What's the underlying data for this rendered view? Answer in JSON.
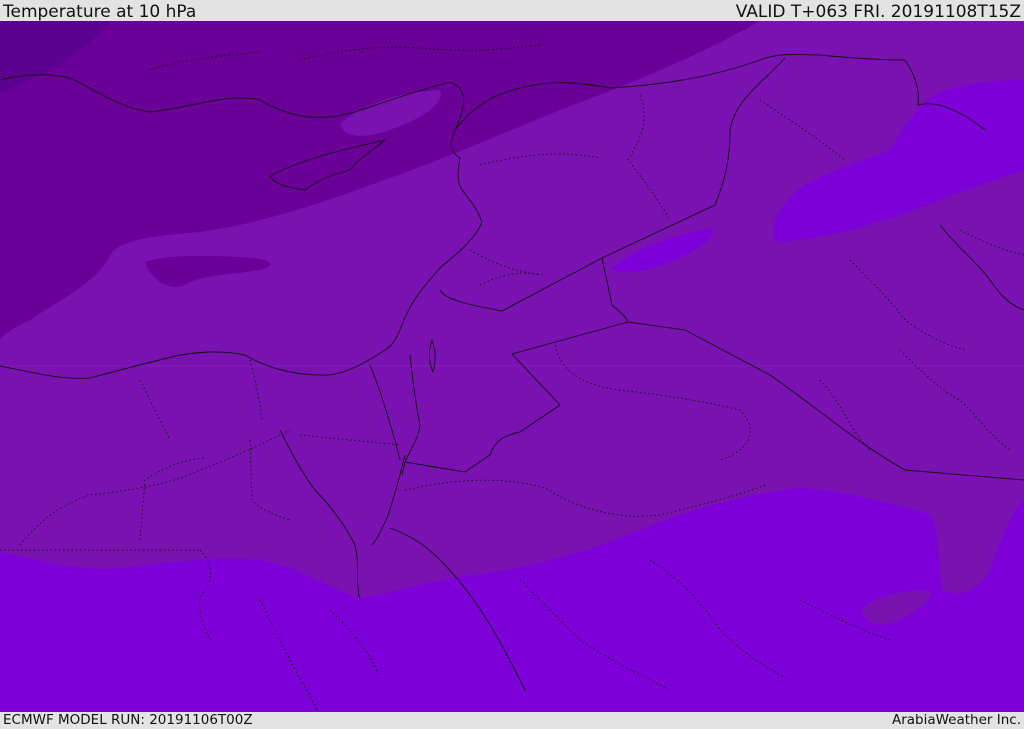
{
  "header": {
    "title": "Temperature at 10 hPa",
    "valid_time": "VALID T+063 FRI. 20191108T15Z"
  },
  "footer": {
    "model_run": "ECMWF MODEL RUN: 20191106T00Z",
    "credit": "ArabiaWeather Inc."
  },
  "map": {
    "colors": {
      "coldest": "#5c0090",
      "cold": "#6a0098",
      "mid": "#7a12b2",
      "warm": "#7e00d8",
      "border": "#111111"
    }
  }
}
